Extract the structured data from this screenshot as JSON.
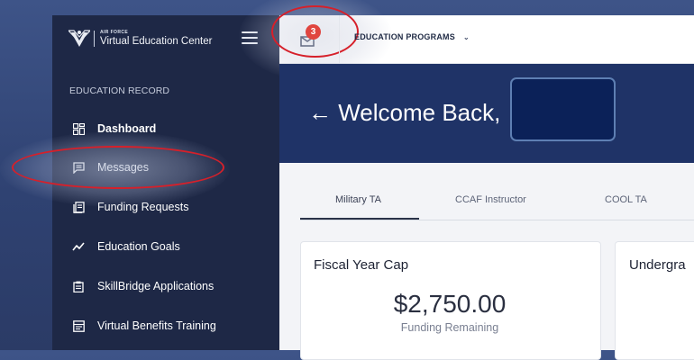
{
  "brand": {
    "org": "AIR FORCE",
    "name": "Virtual Education Center"
  },
  "sidebar": {
    "section_label": "EDUCATION RECORD",
    "items": [
      {
        "label": "Dashboard",
        "icon": "dashboard-icon",
        "active": true
      },
      {
        "label": "Messages",
        "icon": "message-icon",
        "active": false
      },
      {
        "label": "Funding Requests",
        "icon": "document-icon",
        "active": false
      },
      {
        "label": "Education Goals",
        "icon": "trend-icon",
        "active": false
      },
      {
        "label": "SkillBridge Applications",
        "icon": "clipboard-icon",
        "active": false
      },
      {
        "label": "Virtual Benefits Training",
        "icon": "presentation-icon",
        "active": false
      }
    ]
  },
  "topbar": {
    "notifications_count": "3",
    "menu_label": "EDUCATION PROGRAMS",
    "menu_chevron": "⌄"
  },
  "banner": {
    "back_arrow": "←",
    "welcome_text": "Welcome Back,"
  },
  "tabs": [
    {
      "label": "Military TA",
      "active": true
    },
    {
      "label": "CCAF Instructor",
      "active": false
    },
    {
      "label": "COOL TA",
      "active": false
    }
  ],
  "cards": {
    "fiscal_year_cap": {
      "title": "Fiscal Year Cap",
      "amount": "$2,750.00",
      "sub_label": "Funding Remaining"
    },
    "second": {
      "title": "Undergra"
    }
  },
  "colors": {
    "sidebar_bg": "#1e2846",
    "banner_bg": "#1f3367",
    "badge": "#e0453f",
    "annotation_ring": "#d6202a"
  }
}
